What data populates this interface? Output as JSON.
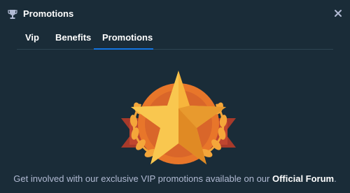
{
  "header": {
    "title": "Promotions",
    "icon": "trophy-icon",
    "close_icon": "close-icon"
  },
  "tabs": [
    {
      "label": "Vip",
      "active": false
    },
    {
      "label": "Benefits",
      "active": false
    },
    {
      "label": "Promotions",
      "active": true
    }
  ],
  "illustration": {
    "icon": "star-laurel-badge-icon"
  },
  "footer": {
    "text_before": "Get involved with our exclusive VIP promotions available on our ",
    "link_label": "Official Forum",
    "text_after": "."
  },
  "colors": {
    "background": "#1a2c38",
    "divider": "#2f4553",
    "tab_underline": "#1475e1",
    "muted_text": "#b1bad3"
  }
}
